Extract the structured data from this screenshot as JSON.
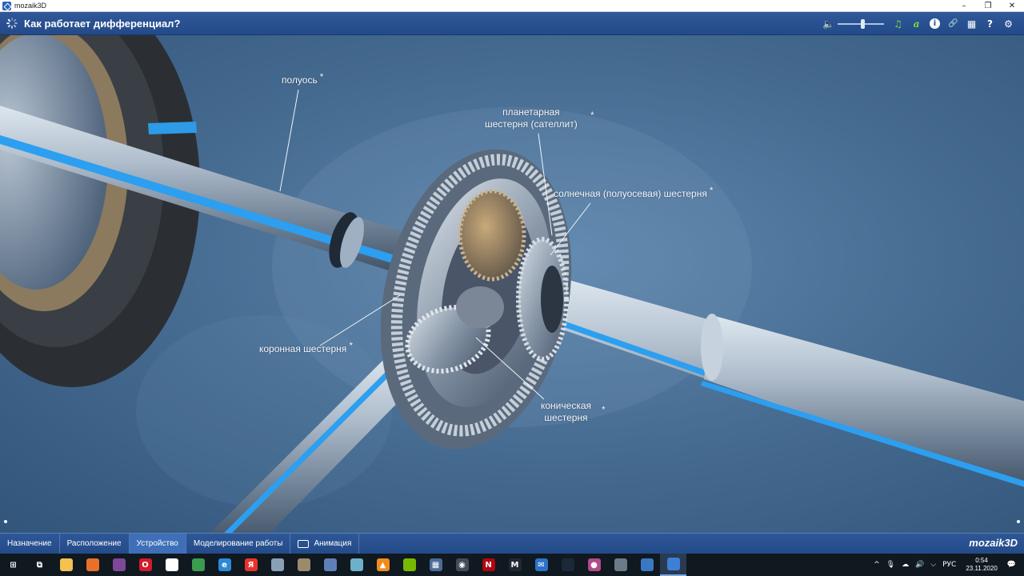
{
  "window": {
    "title": "mozaik3D",
    "minimize": "–",
    "maximize": "❐",
    "close": "✕"
  },
  "header": {
    "title": "Как работает дифференциал?",
    "tools": {
      "speaker": "🔈",
      "music": "♫",
      "text": "a",
      "info": "i",
      "link": "🔗",
      "grid": "▦",
      "help": "?",
      "settings": "⚙"
    },
    "volume_level": 0.55,
    "accent_green": "#7ddc3a"
  },
  "scene": {
    "labels": {
      "half_shaft": "полуось",
      "planet_gear": "планетарная шестерня (сателлит)",
      "planet_gear_line1": "планетарная",
      "planet_gear_line2": "шестерня (сателлит)",
      "sun_gear": "солнечная (полуосевая) шестерня",
      "ring_gear": "коронная шестерня",
      "pinion_line1": "коническая",
      "pinion_line2": "шестерня",
      "star": "*"
    }
  },
  "tabs": [
    {
      "label": "Назначение",
      "active": false
    },
    {
      "label": "Расположение",
      "active": false
    },
    {
      "label": "Устройство",
      "active": true
    },
    {
      "label": "Моделирование работы",
      "active": false
    },
    {
      "label": "Анимация",
      "active": false
    }
  ],
  "brand": "mozaik3D",
  "taskbar": {
    "icons": [
      {
        "name": "windows-start-icon",
        "glyph": "⊞",
        "color": "#ffffff"
      },
      {
        "name": "task-view-icon",
        "glyph": "⧉",
        "color": "#ffffff"
      },
      {
        "name": "file-explorer-icon",
        "glyph": "",
        "color": "#f2c14e"
      },
      {
        "name": "firefox-icon",
        "glyph": "",
        "color": "#e8702a"
      },
      {
        "name": "tor-browser-icon",
        "glyph": "",
        "color": "#7e4798"
      },
      {
        "name": "opera-icon",
        "glyph": "O",
        "color": "#d31b2a"
      },
      {
        "name": "yandex-browser-icon",
        "glyph": "Y",
        "color": "#ffffff"
      },
      {
        "name": "chrome-icon",
        "glyph": "",
        "color": "#3c9c4d"
      },
      {
        "name": "edge-icon",
        "glyph": "e",
        "color": "#2b8ad6"
      },
      {
        "name": "yandex-icon",
        "glyph": "Я",
        "color": "#e8332b"
      },
      {
        "name": "app-icon-1",
        "glyph": "",
        "color": "#8aa0b4"
      },
      {
        "name": "app-icon-2",
        "glyph": "",
        "color": "#9c8a6c"
      },
      {
        "name": "app-icon-3",
        "glyph": "",
        "color": "#5f7fb8"
      },
      {
        "name": "app-icon-4",
        "glyph": "",
        "color": "#6bb1c9"
      },
      {
        "name": "vlc-icon",
        "glyph": "▲",
        "color": "#f08b1c"
      },
      {
        "name": "nvidia-icon",
        "glyph": "",
        "color": "#76b900"
      },
      {
        "name": "calculator-icon",
        "glyph": "▦",
        "color": "#4a6a9a"
      },
      {
        "name": "camera-icon",
        "glyph": "◉",
        "color": "#444c58"
      },
      {
        "name": "netflix-icon",
        "glyph": "N",
        "color": "#b1060f"
      },
      {
        "name": "gmail-icon",
        "glyph": "M",
        "color": "#222831"
      },
      {
        "name": "mail-icon",
        "glyph": "✉",
        "color": "#2b73c6"
      },
      {
        "name": "steam-icon",
        "glyph": "",
        "color": "#1b2838"
      },
      {
        "name": "drop-icon",
        "glyph": "●",
        "color": "#b04a8a"
      },
      {
        "name": "app-icon-5",
        "glyph": "",
        "color": "#6c7a89"
      },
      {
        "name": "store-icon",
        "glyph": "",
        "color": "#3a78c3"
      },
      {
        "name": "mozaik-icon",
        "glyph": "",
        "color": "#3d7fd4",
        "active": true
      }
    ],
    "tray": {
      "chevron": "^",
      "mic": "🎙",
      "network": "☁",
      "volume": "🔊",
      "wifi": "⌵",
      "language": "РУС",
      "time": "0:54",
      "date": "23.11.2020",
      "notifications": "💬"
    }
  }
}
